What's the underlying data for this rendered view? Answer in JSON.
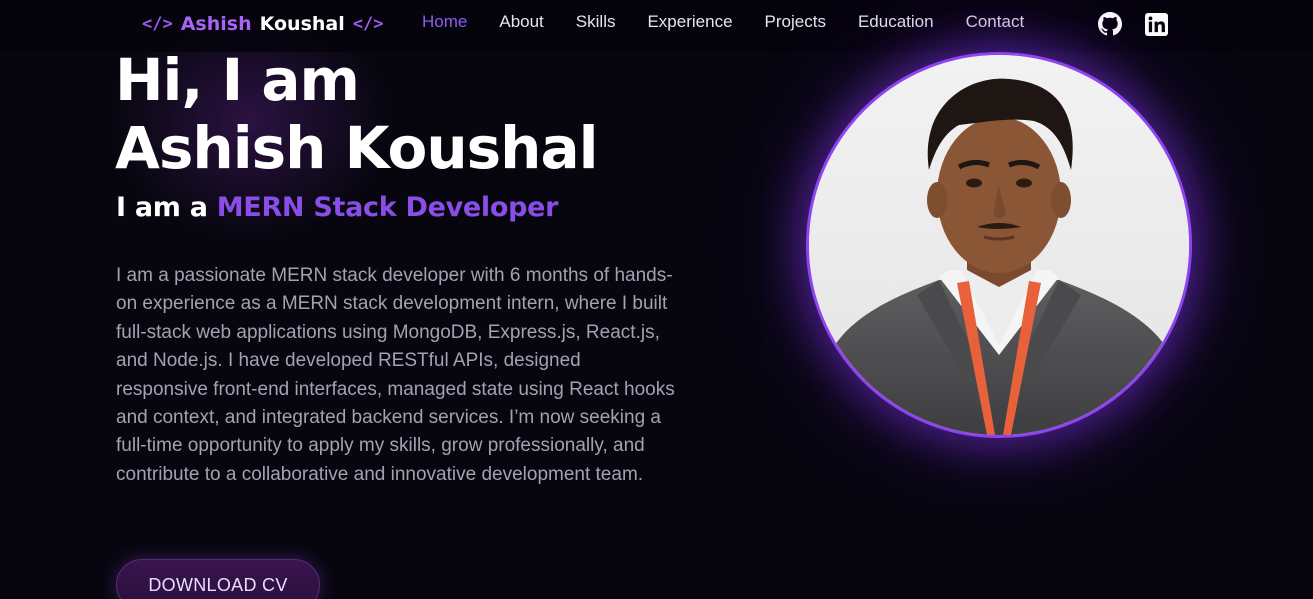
{
  "brand": {
    "first_name": "Ashish",
    "last_name": "Koushal",
    "code_icon_left": "</>",
    "code_icon_right": "</>",
    "accent_color": "#a665f5"
  },
  "nav": {
    "items": [
      {
        "label": "Home",
        "active": true
      },
      {
        "label": "About",
        "active": false
      },
      {
        "label": "Skills",
        "active": false
      },
      {
        "label": "Experience",
        "active": false
      },
      {
        "label": "Projects",
        "active": false
      },
      {
        "label": "Education",
        "active": false
      },
      {
        "label": "Contact",
        "active": false
      }
    ],
    "social_icons": [
      "github-icon",
      "linkedin-icon"
    ]
  },
  "hero": {
    "greeting": "Hi, I am",
    "name": "Ashish Koushal",
    "role_prefix": "I am a ",
    "role": "MERN Stack Developer",
    "bio": "I am a passionate MERN stack developer with 6 months of hands-on experience as a MERN stack development intern, where I built full-stack web applications using MongoDB, Express.js, React.js, and Node.js. I have developed RESTful APIs, designed responsive front-end interfaces, managed state using React hooks and context, and integrated backend services. I’m now seeking a full-time opportunity to apply my skills, grow professionally, and contribute to a collaborative and innovative development team.",
    "download_label": "DOWNLOAD CV"
  },
  "colors": {
    "background": "#07060f",
    "accent": "#8a4de8",
    "text_muted": "#a3a1b2"
  }
}
